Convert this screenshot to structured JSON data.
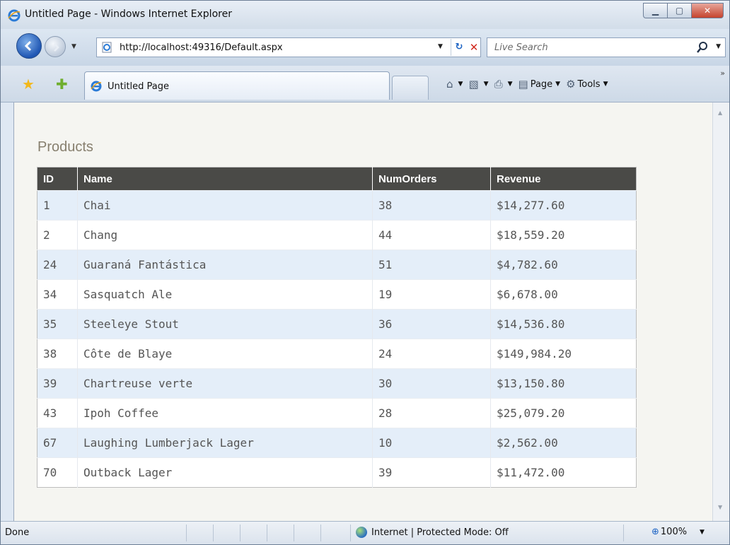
{
  "window": {
    "title": "Untitled Page - Windows Internet Explorer"
  },
  "address_bar": {
    "url": "http://localhost:49316/Default.aspx"
  },
  "search": {
    "placeholder": "Live Search"
  },
  "tabs": [
    {
      "label": "Untitled Page"
    }
  ],
  "command_bar": {
    "page_label": "Page",
    "tools_label": "Tools"
  },
  "page": {
    "heading": "Products",
    "table": {
      "columns": [
        "ID",
        "Name",
        "NumOrders",
        "Revenue"
      ],
      "rows": [
        [
          "1",
          "Chai",
          "38",
          "$14,277.60"
        ],
        [
          "2",
          "Chang",
          "44",
          "$18,559.20"
        ],
        [
          "24",
          "Guaraná Fantástica",
          "51",
          "$4,782.60"
        ],
        [
          "34",
          "Sasquatch Ale",
          "19",
          "$6,678.00"
        ],
        [
          "35",
          "Steeleye Stout",
          "36",
          "$14,536.80"
        ],
        [
          "38",
          "Côte de Blaye",
          "24",
          "$149,984.20"
        ],
        [
          "39",
          "Chartreuse verte",
          "30",
          "$13,150.80"
        ],
        [
          "43",
          "Ipoh Coffee",
          "28",
          "$25,079.20"
        ],
        [
          "67",
          "Laughing Lumberjack Lager",
          "10",
          "$2,562.00"
        ],
        [
          "70",
          "Outback Lager",
          "39",
          "$11,472.00"
        ]
      ]
    }
  },
  "status_bar": {
    "status": "Done",
    "zone": "Internet | Protected Mode: Off",
    "zoom": "100%"
  },
  "colors": {
    "heading": "#877f6e",
    "table_header_bg": "#4a4a47",
    "row_alt_bg": "#e4eef9",
    "page_bg": "#f5f5f1"
  }
}
